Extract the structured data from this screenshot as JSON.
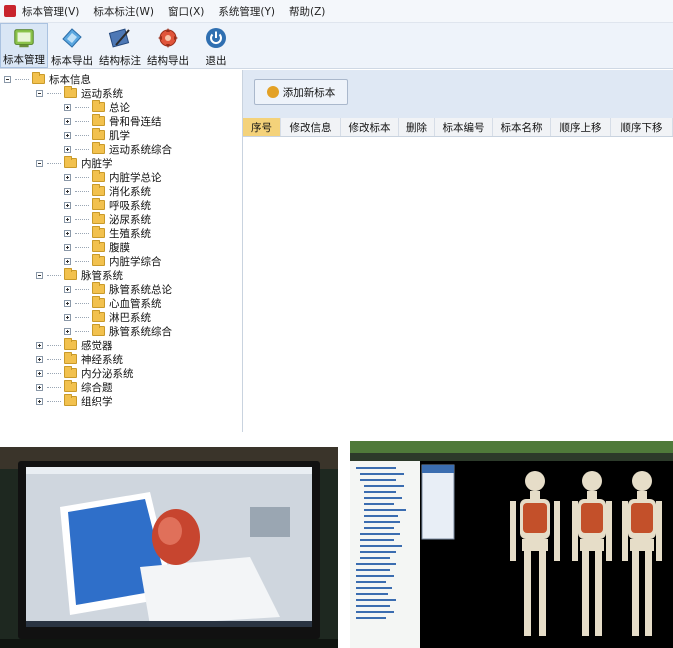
{
  "menubar": {
    "items": [
      "标本管理(V)",
      "标本标注(W)",
      "窗口(X)",
      "系统管理(Y)",
      "帮助(Z)"
    ]
  },
  "toolbar": {
    "tools": [
      {
        "label": "标本管理",
        "icon": "specimen-manage-icon"
      },
      {
        "label": "标本导出",
        "icon": "specimen-export-icon"
      },
      {
        "label": "结构标注",
        "icon": "structure-annotate-icon"
      },
      {
        "label": "结构导出",
        "icon": "structure-export-icon"
      },
      {
        "label": "退出",
        "icon": "power-icon"
      }
    ]
  },
  "tree": {
    "root": "标本信息",
    "nodes": [
      {
        "label": "运动系统",
        "children": [
          "总论",
          "骨和骨连结",
          "肌学",
          "运动系统综合"
        ]
      },
      {
        "label": "内脏学",
        "children": [
          "内脏学总论",
          "消化系统",
          "呼吸系统",
          "泌尿系统",
          "生殖系统",
          "腹膜",
          "内脏学综合"
        ]
      },
      {
        "label": "脉管系统",
        "children": [
          "脉管系统总论",
          "心血管系统",
          "淋巴系统",
          "脉管系统综合"
        ]
      },
      {
        "label": "感觉器",
        "children": []
      },
      {
        "label": "神经系统",
        "children": []
      },
      {
        "label": "内分泌系统",
        "children": []
      },
      {
        "label": "综合题",
        "children": []
      },
      {
        "label": "组织学",
        "children": []
      }
    ]
  },
  "content": {
    "add_button": "添加新标本",
    "columns": [
      "序号",
      "修改信息",
      "修改标本",
      "删除",
      "标本编号",
      "标本名称",
      "顺序上移",
      "顺序下移"
    ]
  },
  "colors": {
    "toolbar_bg": "#eef3fa",
    "header_highlight": "#f4d27a",
    "folder": "#f2c14e"
  }
}
